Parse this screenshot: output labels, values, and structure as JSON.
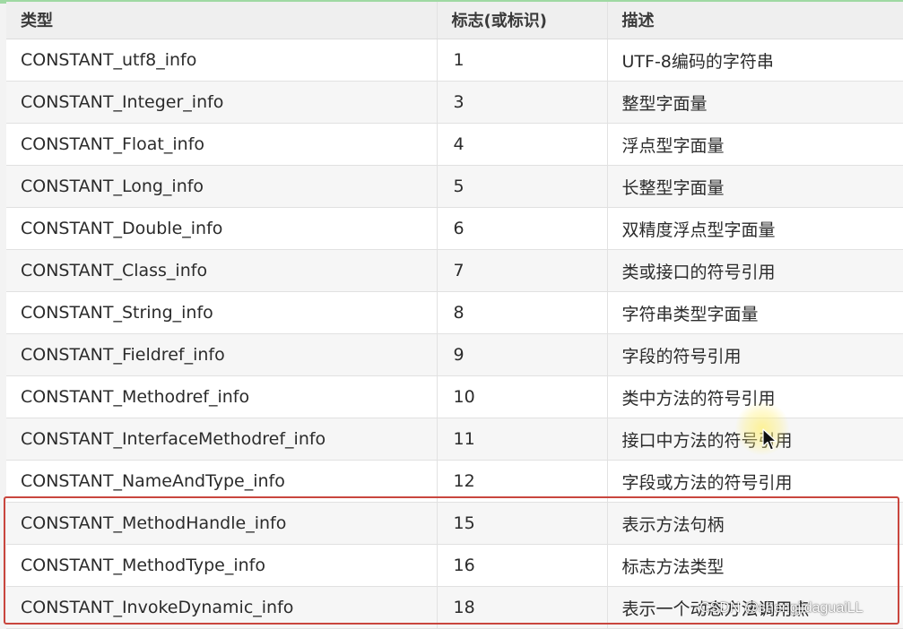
{
  "table": {
    "headers": [
      "类型",
      "标志(或标识)",
      "描述"
    ],
    "rows": [
      {
        "type": "CONSTANT_utf8_info",
        "tag": "1",
        "desc": "UTF-8编码的字符串"
      },
      {
        "type": "CONSTANT_Integer_info",
        "tag": "3",
        "desc": "整型字面量"
      },
      {
        "type": "CONSTANT_Float_info",
        "tag": "4",
        "desc": "浮点型字面量"
      },
      {
        "type": "CONSTANT_Long_info",
        "tag": "5",
        "desc": "长整型字面量"
      },
      {
        "type": "CONSTANT_Double_info",
        "tag": "6",
        "desc": "双精度浮点型字面量"
      },
      {
        "type": "CONSTANT_Class_info",
        "tag": "7",
        "desc": "类或接口的符号引用"
      },
      {
        "type": "CONSTANT_String_info",
        "tag": "8",
        "desc": "字符串类型字面量"
      },
      {
        "type": "CONSTANT_Fieldref_info",
        "tag": "9",
        "desc": "字段的符号引用"
      },
      {
        "type": "CONSTANT_Methodref_info",
        "tag": "10",
        "desc": "类中方法的符号引用"
      },
      {
        "type": "CONSTANT_InterfaceMethodref_info",
        "tag": "11",
        "desc": "接口中方法的符号引用"
      },
      {
        "type": "CONSTANT_NameAndType_info",
        "tag": "12",
        "desc": "字段或方法的符号引用"
      },
      {
        "type": "CONSTANT_MethodHandle_info",
        "tag": "15",
        "desc": "表示方法句柄"
      },
      {
        "type": "CONSTANT_MethodType_info",
        "tag": "16",
        "desc": "标志方法类型"
      },
      {
        "type": "CONSTANT_InvokeDynamic_info",
        "tag": "18",
        "desc": "表示一个动态方法调用点"
      }
    ]
  },
  "watermark": "CSDN @shengjidaguaiLL",
  "colors": {
    "highlight_border": "#c9463e",
    "top_strip": "#9fd9a3"
  },
  "icons": {
    "cursor": "mouse-pointer-icon"
  }
}
